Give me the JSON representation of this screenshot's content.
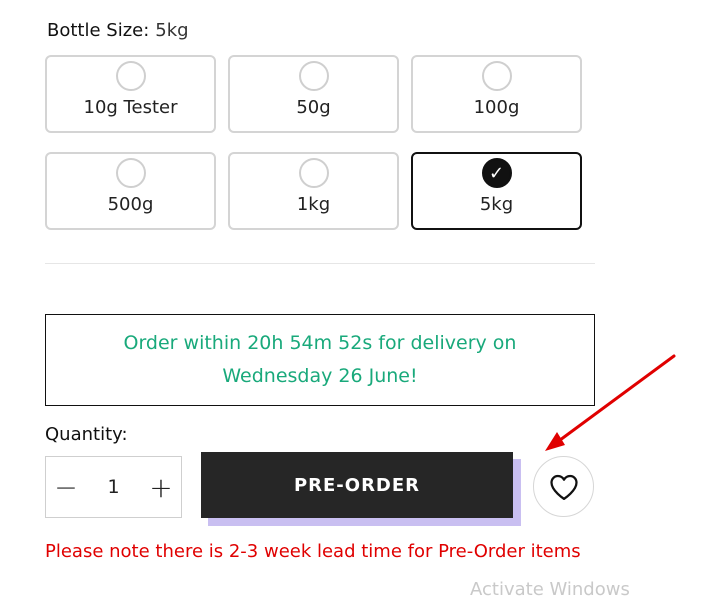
{
  "variant": {
    "label": "Bottle Size:",
    "selected_value": "5kg",
    "options": [
      {
        "label": "10g Tester",
        "selected": false
      },
      {
        "label": "50g",
        "selected": false
      },
      {
        "label": "100g",
        "selected": false
      },
      {
        "label": "500g",
        "selected": false
      },
      {
        "label": "1kg",
        "selected": false
      },
      {
        "label": "5kg",
        "selected": true
      }
    ],
    "check_glyph": "✓"
  },
  "delivery": {
    "message": "Order within 20h 54m 52s for delivery on Wednesday 26 June!",
    "color": "#19a97b"
  },
  "quantity": {
    "label": "Quantity:",
    "minus": "−",
    "value": "1",
    "plus": "+"
  },
  "actions": {
    "preorder_label": "PRE-ORDER",
    "wishlist_icon": "heart-icon",
    "preorder_bg": "#262626",
    "preorder_shadow": "#c9bff1"
  },
  "notice": {
    "text": "Please note there is 2-3 week lead time for Pre-Order items",
    "color": "#e00000"
  },
  "annotation": {
    "icon": "red-arrow-icon",
    "color": "#e00000"
  },
  "faded_overlay_text": "Activate Windows"
}
